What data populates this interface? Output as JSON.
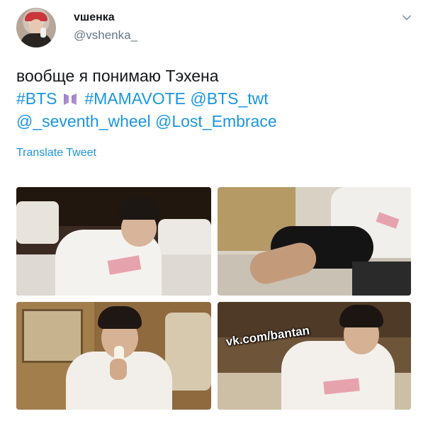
{
  "tweet": {
    "display_name": "vшенка",
    "username": "@vshenka_",
    "text_line1": "вообще я понимаю Тэхена",
    "hashtag_bts": "#BTS",
    "hashtag_mamavote": "#MAMAVOTE",
    "mention_bts_twt": "@BTS_twt",
    "mention_seventh_wheel": "@_seventh_wheel",
    "mention_lost_embrace": "@Lost_Embrace",
    "translate_label": "Translate Tweet",
    "emoji": "bts-logo-emoji",
    "link_color": "#1b95e0"
  },
  "media": {
    "watermark": "vk.com/bantan",
    "photos": [
      "photo-1",
      "photo-2",
      "photo-3",
      "photo-4"
    ]
  },
  "icons": {
    "more": "chevron-down-icon"
  }
}
